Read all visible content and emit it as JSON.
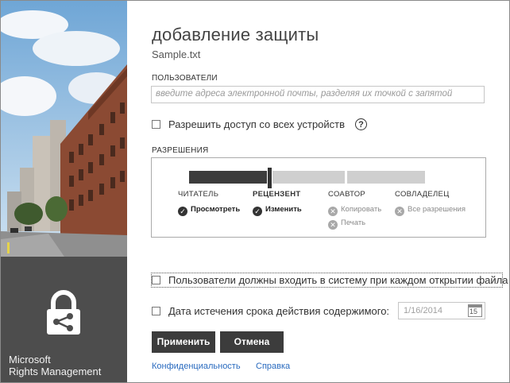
{
  "brand": {
    "line1": "Microsoft",
    "line2": "Rights Management"
  },
  "header": {
    "title": "добавление защиты",
    "filename": "Sample.txt"
  },
  "users": {
    "label": "ПОЛЬЗОВАТЕЛИ",
    "placeholder": "введите адреса электронной почты, разделяя их точкой с запятой"
  },
  "allow_all_devices": {
    "label": "Разрешить доступ со всех устройств",
    "checked": false,
    "help_icon": "question-circle-icon",
    "help_glyph": "?"
  },
  "permissions": {
    "label": "РАЗРЕШЕНИЯ",
    "selected_level": 1,
    "roles": [
      {
        "name": "ЧИТАТЕЛЬ",
        "selected": false
      },
      {
        "name": "РЕЦЕНЗЕНТ",
        "selected": true
      },
      {
        "name": "СОАВТОР",
        "selected": false
      },
      {
        "name": "СОВЛАДЕЛЕЦ",
        "selected": false
      }
    ],
    "items": [
      {
        "label": "Просмотреть",
        "granted": true,
        "icon": "check-icon",
        "glyph": "✓"
      },
      {
        "label": "Изменить",
        "granted": true,
        "icon": "check-icon",
        "glyph": "✓"
      },
      {
        "label": "Копировать",
        "granted": false,
        "icon": "x-icon",
        "glyph": "✕"
      },
      {
        "label": "Печать",
        "granted": false,
        "icon": "x-icon",
        "glyph": "✕"
      },
      {
        "label": "Все разрешения",
        "granted": false,
        "icon": "x-icon",
        "glyph": "✕"
      }
    ]
  },
  "require_signin": {
    "label": "Пользователи должны входить в систему при каждом открытии файла",
    "checked": false
  },
  "expiry": {
    "label": "Дата истечения срока действия содержимого:",
    "checked": false,
    "date_value": "1/16/2014",
    "calendar_icon": "calendar-icon",
    "calendar_day": "15"
  },
  "buttons": {
    "apply": "Применить",
    "cancel": "Отмена"
  },
  "links": {
    "privacy": "Конфиденциальность",
    "help": "Справка"
  },
  "colors": {
    "dark": "#3c3c3c",
    "link": "#2a6bbf",
    "slider_off": "#cfcfcf"
  }
}
